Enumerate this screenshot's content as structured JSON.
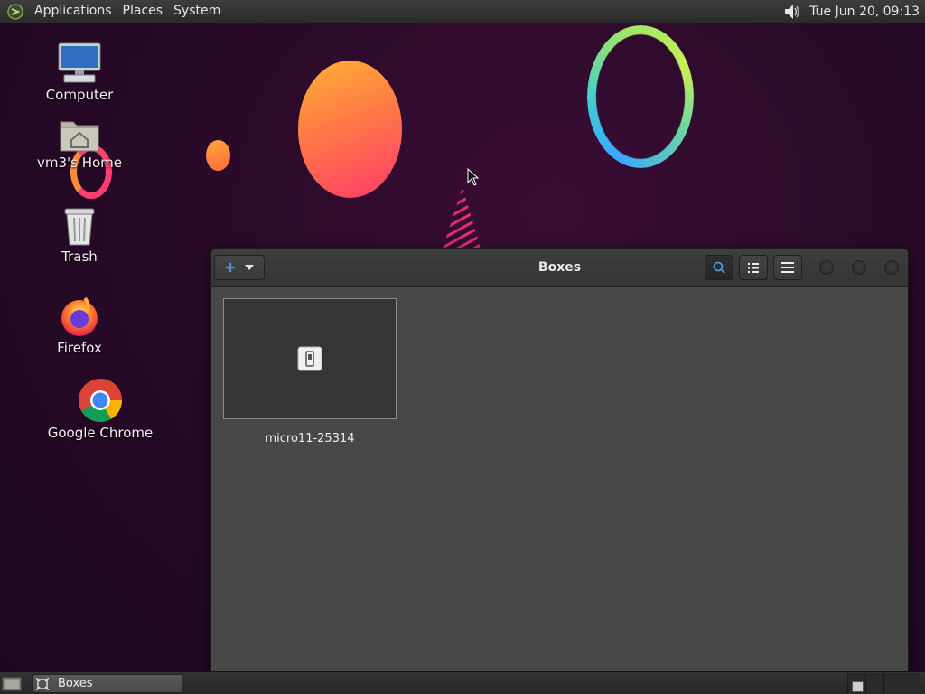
{
  "top_panel": {
    "menus": [
      "Applications",
      "Places",
      "System"
    ],
    "clock": "Tue Jun 20, 09:13",
    "icons": {
      "logo": "distro-logo-icon",
      "volume": "volume-icon"
    }
  },
  "desktop": {
    "icons": [
      {
        "label": "Computer",
        "icon": "computer-icon"
      },
      {
        "label": "vm3's Home",
        "icon": "home-folder-icon"
      },
      {
        "label": "Trash",
        "icon": "trash-icon"
      },
      {
        "label": "Firefox",
        "icon": "firefox-icon"
      },
      {
        "label": "Google Chrome",
        "icon": "chrome-icon"
      }
    ]
  },
  "window": {
    "title": "Boxes",
    "toolbar": {
      "new_button_icons": [
        "plus-icon",
        "chevron-down-icon"
      ],
      "buttons": [
        "search-icon",
        "list-view-icon",
        "hamburger-menu-icon"
      ],
      "window_controls": [
        "minimize-button",
        "maximize-button",
        "close-button"
      ]
    },
    "boxes": [
      {
        "name": "micro11-25314",
        "icon": "machine-icon"
      }
    ]
  },
  "bottom_panel": {
    "tasks": [
      {
        "label": "Boxes",
        "icon": "boxes-app-icon"
      }
    ]
  },
  "colors": {
    "accent_blue": "#3584e4",
    "panel_bg": "#2b2b2b",
    "window_bg": "#484848"
  }
}
